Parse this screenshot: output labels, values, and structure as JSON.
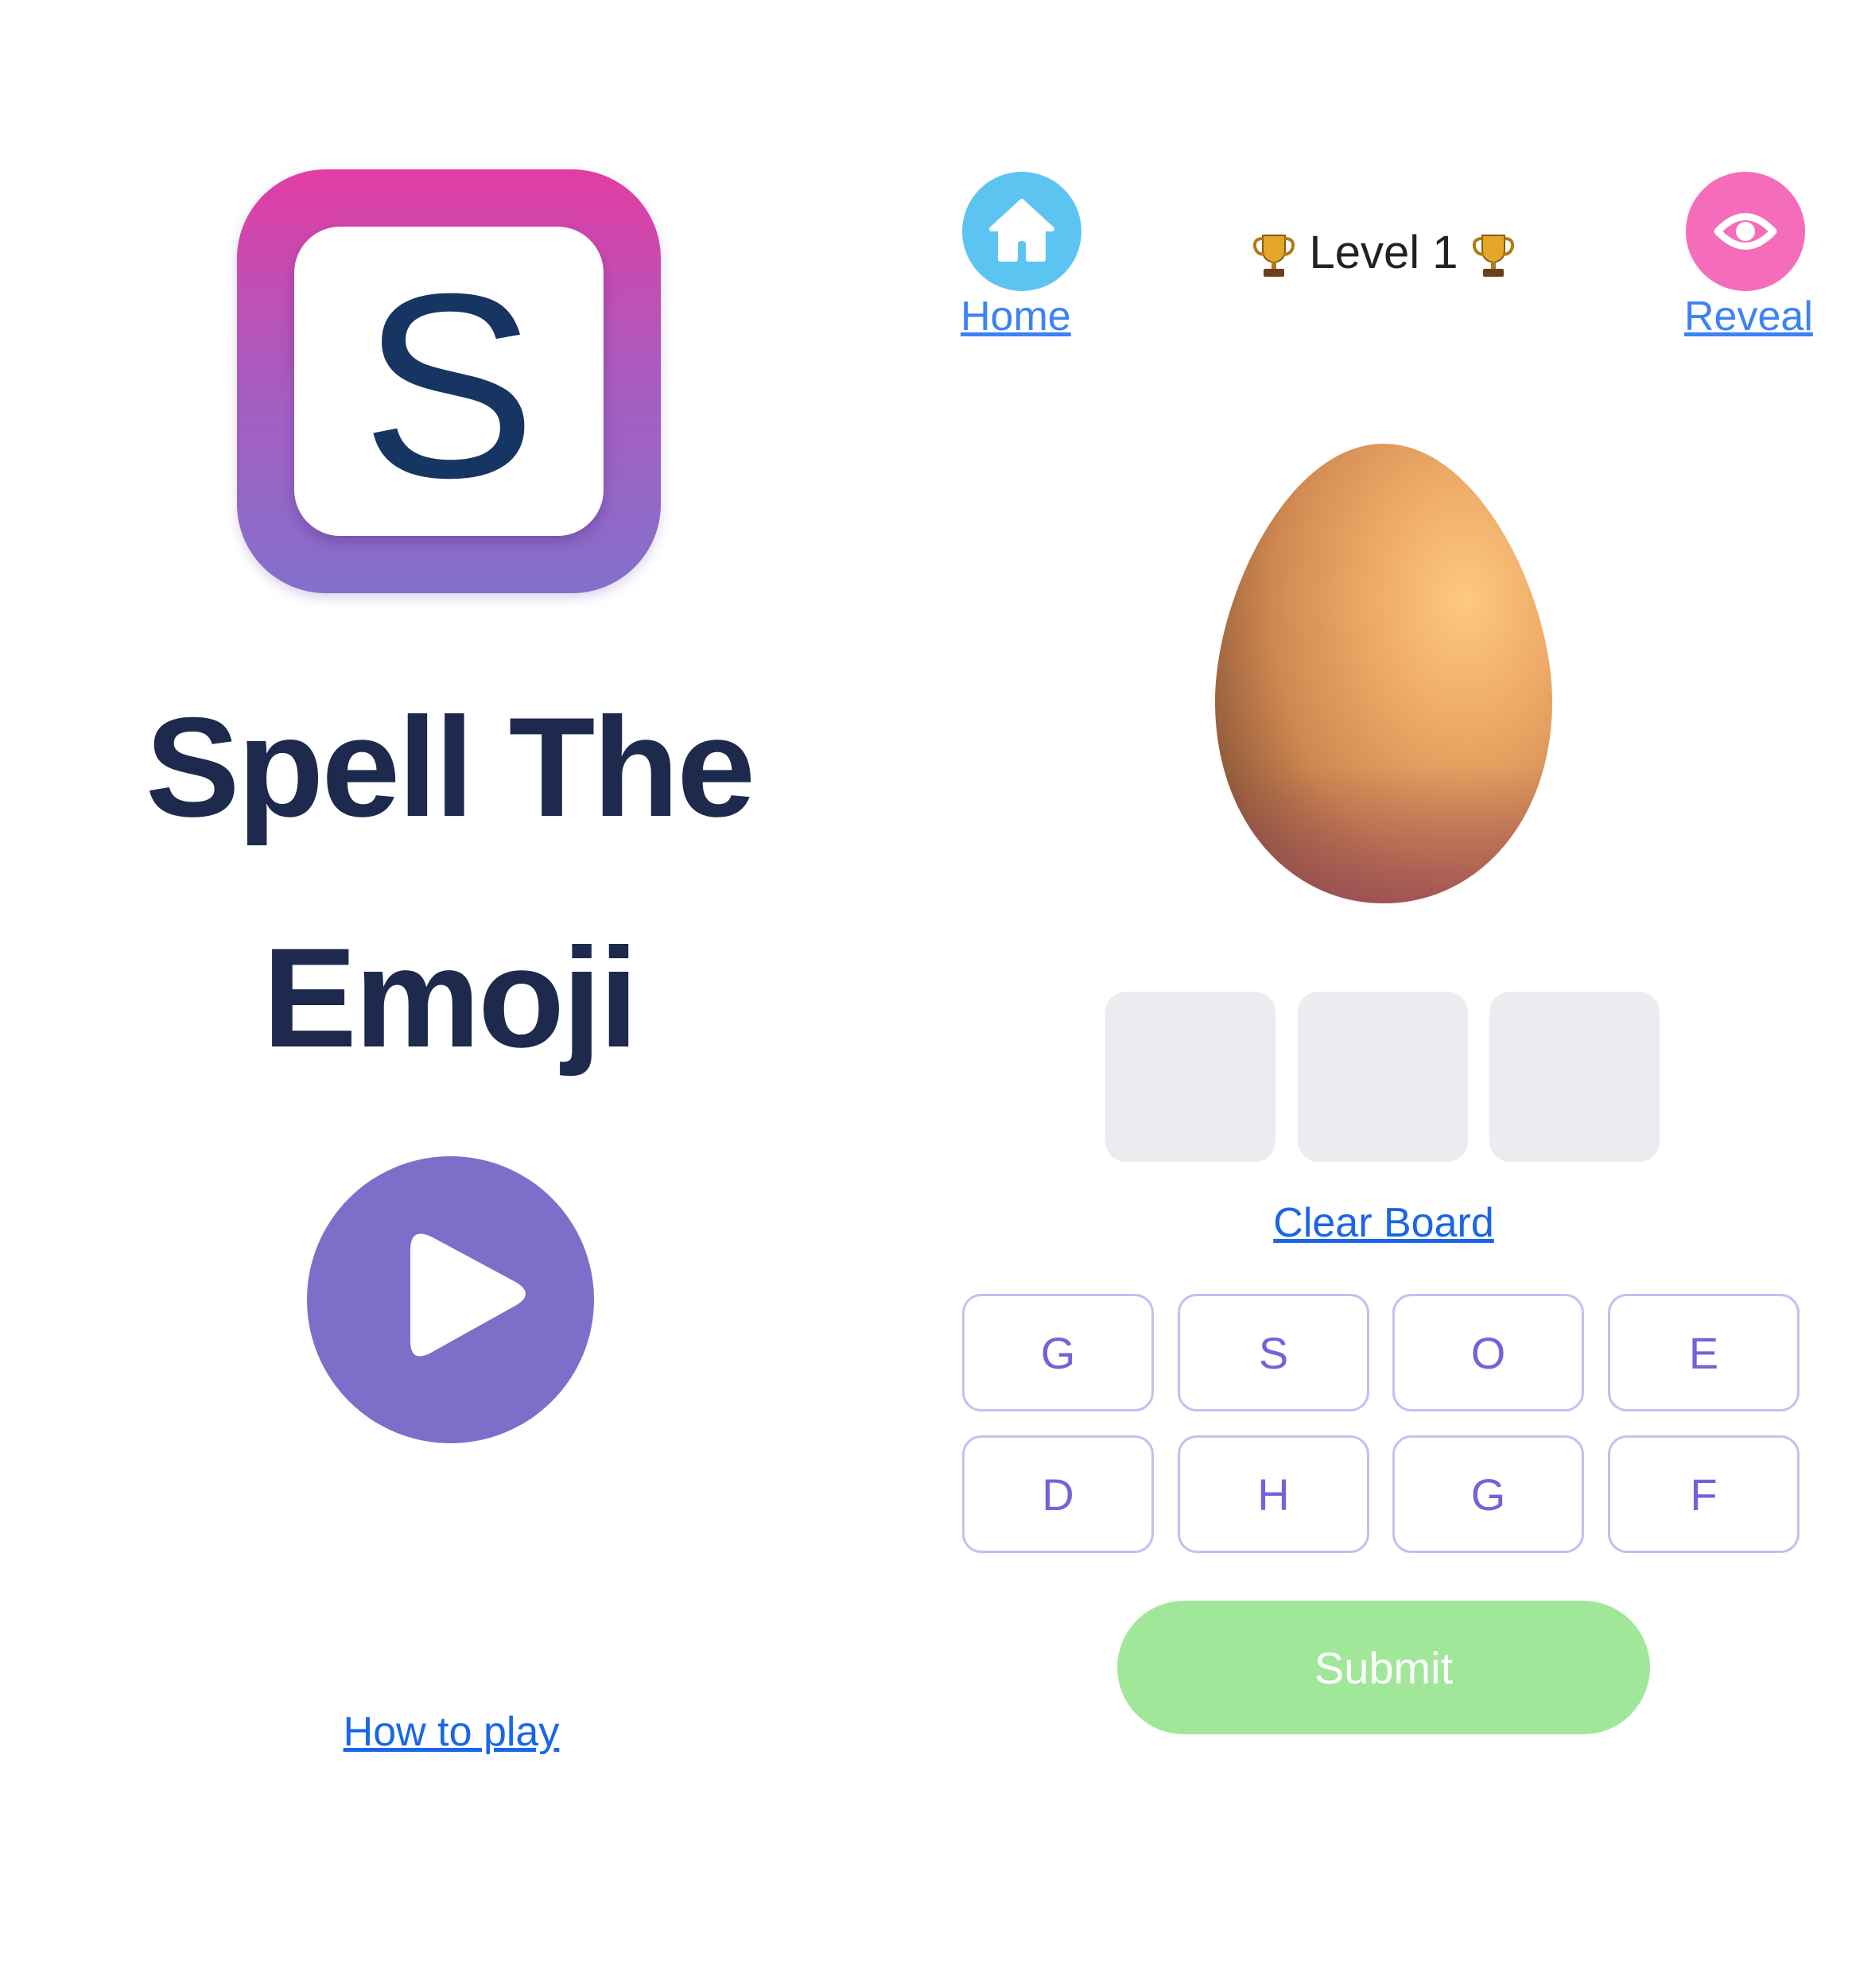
{
  "home_screen": {
    "logo_letter": "S",
    "title_line1": "Spell The",
    "title_line2": "Emoji",
    "how_to_play_label": "How to play"
  },
  "game_screen": {
    "home_label": "Home",
    "reveal_label": "Reveal",
    "level_text": "Level 1",
    "emoji_name": "egg",
    "answer_slots": 3,
    "clear_board_label": "Clear Board",
    "letters": [
      "G",
      "S",
      "O",
      "E",
      "D",
      "H",
      "G",
      "F"
    ],
    "submit_label": "Submit"
  },
  "icons": {
    "home": "home-icon",
    "reveal": "eye-icon",
    "play": "play-icon",
    "trophy": "trophy-icon"
  },
  "colors": {
    "home_button": "#5bc4f1",
    "reveal_button": "#f56cba",
    "play_button": "#7b6fca",
    "submit_button": "#a0e79a",
    "letter_key_border": "#c9bdf1",
    "letter_key_text": "#7a5fd8",
    "link": "#1a66e6",
    "title": "#1d2a4d"
  }
}
